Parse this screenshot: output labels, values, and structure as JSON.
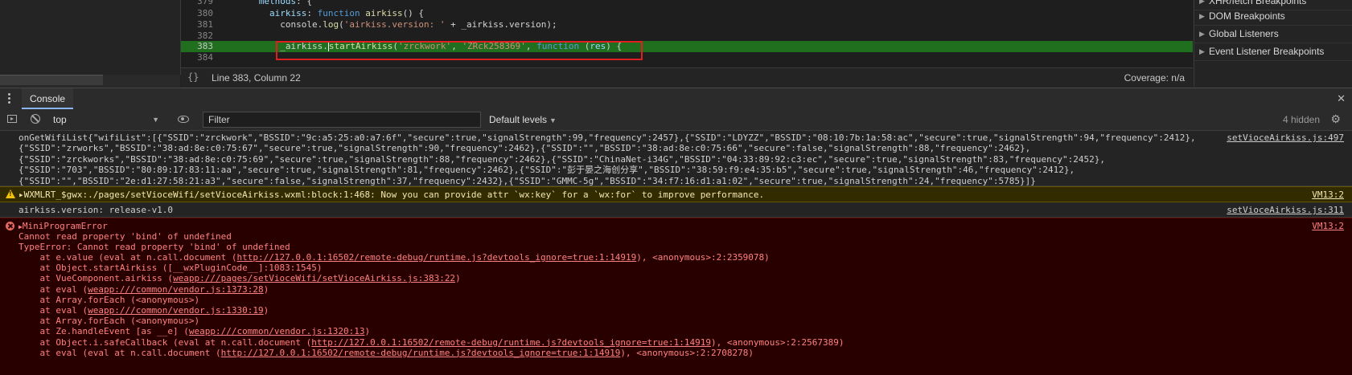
{
  "editor": {
    "lines": [
      {
        "num": "379",
        "indent": "      ",
        "parts": [
          {
            "t": "methods",
            "c": "k-prop"
          },
          {
            "t": ": {",
            "c": "k-punc"
          }
        ]
      },
      {
        "num": "380",
        "indent": "        ",
        "parts": [
          {
            "t": "airkiss",
            "c": "k-prop"
          },
          {
            "t": ": ",
            "c": "k-punc"
          },
          {
            "t": "function ",
            "c": "k-fn"
          },
          {
            "t": "airkiss",
            "c": "k-fnname"
          },
          {
            "t": "() {",
            "c": "k-punc"
          }
        ]
      },
      {
        "num": "381",
        "indent": "          ",
        "parts": [
          {
            "t": "console.",
            "c": "k-punc"
          },
          {
            "t": "log",
            "c": "k-fnname"
          },
          {
            "t": "(",
            "c": "k-punc"
          },
          {
            "t": "'airkiss.version: '",
            "c": "k-str"
          },
          {
            "t": " + _airkiss.version);",
            "c": "k-punc"
          }
        ]
      },
      {
        "num": "382",
        "indent": "",
        "parts": []
      },
      {
        "num": "383",
        "indent": "          ",
        "parts": [
          {
            "t": "_airkiss.",
            "c": "k-punc"
          },
          {
            "t": "startAirkiss",
            "c": "k-fnname"
          },
          {
            "t": "(",
            "c": "k-punc"
          },
          {
            "t": "'zrckwork'",
            "c": "k-str"
          },
          {
            "t": ", ",
            "c": "k-punc"
          },
          {
            "t": "'ZRck258369'",
            "c": "k-str"
          },
          {
            "t": ", ",
            "c": "k-punc"
          },
          {
            "t": "function ",
            "c": "k-fn"
          },
          {
            "t": "(",
            "c": "k-punc"
          },
          {
            "t": "res",
            "c": "k-param"
          },
          {
            "t": ") {",
            "c": "k-punc"
          }
        ]
      },
      {
        "num": "384",
        "indent": "",
        "parts": []
      }
    ],
    "status": {
      "curly": "{}",
      "position": "Line 383, Column 22",
      "coverage": "Coverage: n/a"
    }
  },
  "side_panel": {
    "items": [
      "XHR/fetch Breakpoints",
      "DOM Breakpoints",
      "Global Listeners",
      "Event Listener Breakpoints"
    ]
  },
  "drawer": {
    "tab_console": "Console",
    "close": "✕"
  },
  "toolbar": {
    "context": "top",
    "filter_placeholder": "Filter",
    "levels": "Default levels",
    "hidden": "4 hidden"
  },
  "console": {
    "wifi_lines": [
      "onGetWifiList{\"wifiList\":[{\"SSID\":\"zrckwork\",\"BSSID\":\"9c:a5:25:a0:a7:6f\",\"secure\":true,\"signalStrength\":99,\"frequency\":2457},{\"SSID\":\"LDYZZ\",\"BSSID\":\"08:10:7b:1a:58:ac\",\"secure\":true,\"signalStrength\":94,\"frequency\":2412},",
      "{\"SSID\":\"zrworks\",\"BSSID\":\"38:ad:8e:c0:75:67\",\"secure\":true,\"signalStrength\":90,\"frequency\":2462},{\"SSID\":\"\",\"BSSID\":\"38:ad:8e:c0:75:66\",\"secure\":false,\"signalStrength\":88,\"frequency\":2462},",
      "{\"SSID\":\"zrckworks\",\"BSSID\":\"38:ad:8e:c0:75:69\",\"secure\":true,\"signalStrength\":88,\"frequency\":2462},{\"SSID\":\"ChinaNet-i34G\",\"BSSID\":\"04:33:89:92:c3:ec\",\"secure\":true,\"signalStrength\":83,\"frequency\":2452},",
      "{\"SSID\":\"703\",\"BSSID\":\"80:89:17:83:11:aa\",\"secure\":true,\"signalStrength\":81,\"frequency\":2462},{\"SSID\":\"彭于晏之海创分享\",\"BSSID\":\"38:59:f9:e4:35:b5\",\"secure\":true,\"signalStrength\":46,\"frequency\":2412},",
      "{\"SSID\":\"\",\"BSSID\":\"2e:d1:27:58:21:a3\",\"secure\":false,\"signalStrength\":37,\"frequency\":2432},{\"SSID\":\"GMMC-5g\",\"BSSID\":\"34:f7:16:d1:a1:02\",\"secure\":true,\"signalStrength\":24,\"frequency\":5785}]}"
    ],
    "wifi_source": "setVioceAirkiss.js:497",
    "warn_text": "▸WXMLRT_$gwx:./pages/setVioceWifi/setVioceAirkiss.wxml:block:1:468: Now you can provide attr `wx:key` for a `wx:for` to improve performance.",
    "warn_source": "VM13:2",
    "version_text": "airkiss.version: release-v1.0",
    "version_source": "setVioceAirkiss.js:311",
    "error": {
      "title": "MiniProgramError",
      "source": "VM13:2",
      "message": "Cannot read property 'bind' of undefined",
      "type_line": "TypeError: Cannot read property 'bind' of undefined",
      "stack": [
        {
          "pre": "    at e.value (eval at n.call.document (",
          "link": "http://127.0.0.1:16502/remote-debug/runtime.js?devtools_ignore=true:1:14919",
          "post": "), <anonymous>:2:2359078)"
        },
        {
          "pre": "    at Object.startAirkiss ([__wxPluginCode__]:1083:1545)",
          "link": "",
          "post": ""
        },
        {
          "pre": "    at VueComponent.airkiss (",
          "link": "weapp:///pages/setVioceWifi/setVioceAirkiss.js:383:22",
          "post": ")"
        },
        {
          "pre": "    at eval (",
          "link": "weapp:///common/vendor.js:1373:28",
          "post": ")"
        },
        {
          "pre": "    at Array.forEach (<anonymous>)",
          "link": "",
          "post": ""
        },
        {
          "pre": "    at eval (",
          "link": "weapp:///common/vendor.js:1330:19",
          "post": ")"
        },
        {
          "pre": "    at Array.forEach (<anonymous>)",
          "link": "",
          "post": ""
        },
        {
          "pre": "    at Ze.handleEvent [as __e] (",
          "link": "weapp:///common/vendor.js:1320:13",
          "post": ")"
        },
        {
          "pre": "    at Object.i.safeCallback (eval at n.call.document (",
          "link": "http://127.0.0.1:16502/remote-debug/runtime.js?devtools_ignore=true:1:14919",
          "post": "), <anonymous>:2:2567389)"
        },
        {
          "pre": "    at eval (eval at n.call.document (",
          "link": "http://127.0.0.1:16502/remote-debug/runtime.js?devtools_ignore=true:1:14919",
          "post": "), <anonymous>:2:2708278)"
        }
      ]
    }
  },
  "colors": {
    "highlight_line": "#1f6f1f",
    "annotation_box": "#e02020",
    "error_bg": "#290000",
    "warn_bg": "#332b00"
  }
}
